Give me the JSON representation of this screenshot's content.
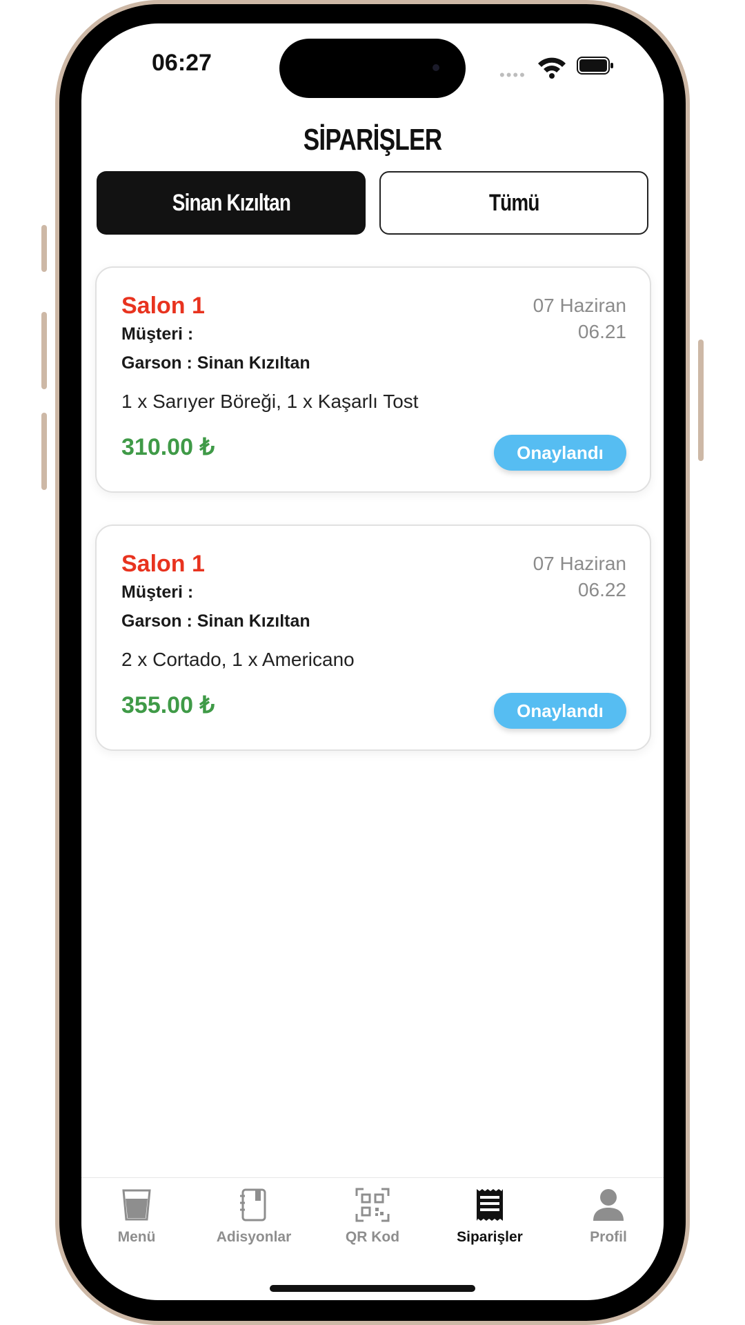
{
  "status_bar": {
    "time": "06:27",
    "dots": "••••"
  },
  "page": {
    "title": "SİPARİŞLER"
  },
  "tabs": [
    {
      "label": "Sinan Kızıltan",
      "active": true
    },
    {
      "label": "Tümü",
      "active": false
    }
  ],
  "orders": [
    {
      "table": "Salon 1",
      "date": "07 Haziran",
      "time": "06.21",
      "customer": "Müşteri :",
      "waiter": "Garson : Sinan Kızıltan",
      "items": "1 x Sarıyer Böreği, 1 x Kaşarlı Tost",
      "price": "310.00 ₺",
      "status": "Onaylandı"
    },
    {
      "table": "Salon 1",
      "date": "07 Haziran",
      "time": "06.22",
      "customer": "Müşteri :",
      "waiter": "Garson : Sinan Kızıltan",
      "items": "2 x Cortado, 1 x Americano",
      "price": "355.00 ₺",
      "status": "Onaylandı"
    }
  ],
  "tabbar": [
    {
      "label": "Menü",
      "icon": "cup-icon"
    },
    {
      "label": "Adisyonlar",
      "icon": "notebook-icon"
    },
    {
      "label": "QR Kod",
      "icon": "qr-code-icon"
    },
    {
      "label": "Siparişler",
      "icon": "receipt-icon",
      "active": true
    },
    {
      "label": "Profil",
      "icon": "person-icon"
    }
  ],
  "colors": {
    "accent_red": "#e8331f",
    "price_green": "#3f9a47",
    "badge_blue": "#56bdf2",
    "tab_active_bg": "#121212"
  }
}
